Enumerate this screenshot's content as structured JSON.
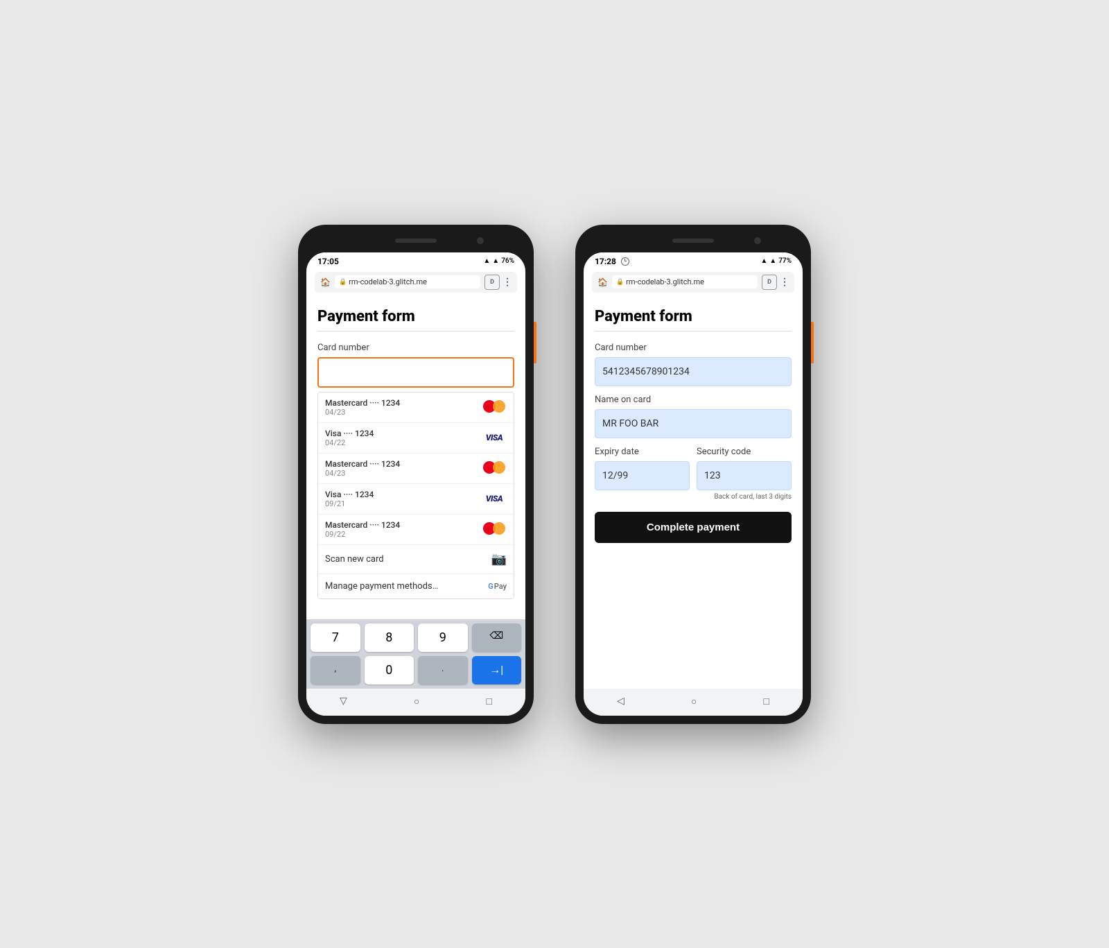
{
  "left_phone": {
    "status": {
      "time": "17:05",
      "signal": "▲",
      "wifi": "▲",
      "battery": "76%"
    },
    "browser": {
      "url": "rm-codelab-3.glitch.me"
    },
    "page": {
      "title": "Payment form",
      "card_label": "Card number",
      "card_placeholder": ""
    },
    "autocomplete": {
      "items": [
        {
          "brand": "Mastercard",
          "dots": "••••",
          "last4": "1234",
          "expiry": "04/23",
          "type": "mc"
        },
        {
          "brand": "Visa",
          "dots": "••••",
          "last4": "1234",
          "expiry": "04/22",
          "type": "visa"
        },
        {
          "brand": "Mastercard",
          "dots": "••••",
          "last4": "1234",
          "expiry": "04/23",
          "type": "mc"
        },
        {
          "brand": "Visa",
          "dots": "••••",
          "last4": "1234",
          "expiry": "09/21",
          "type": "visa"
        },
        {
          "brand": "Mastercard",
          "dots": "••••",
          "last4": "1234",
          "expiry": "09/22",
          "type": "mc"
        }
      ],
      "scan_label": "Scan new card",
      "manage_label": "Manage payment methods…"
    },
    "keyboard": {
      "keys": [
        "7",
        "8",
        "9",
        "⌫",
        ",",
        "0",
        ".",
        null
      ]
    }
  },
  "right_phone": {
    "status": {
      "time": "17:28",
      "signal": "▲",
      "wifi": "▲",
      "battery": "77%"
    },
    "browser": {
      "url": "rm-codelab-3.glitch.me"
    },
    "page": {
      "title": "Payment form",
      "card_number_label": "Card number",
      "card_number_value": "5412345678901234",
      "name_label": "Name on card",
      "name_value": "MR FOO BAR",
      "expiry_label": "Expiry date",
      "expiry_value": "12/99",
      "security_label": "Security code",
      "security_value": "123",
      "security_hint": "Back of card, last 3 digits",
      "submit_label": "Complete payment"
    }
  }
}
